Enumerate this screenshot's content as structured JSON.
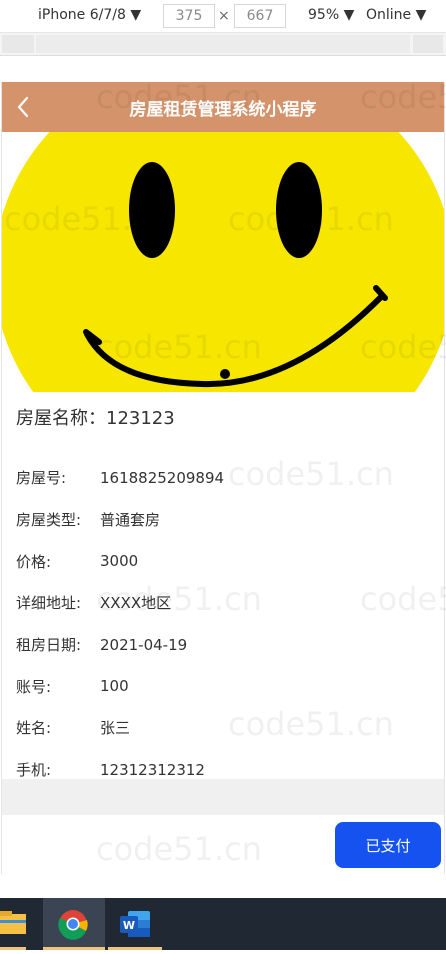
{
  "devtools": {
    "device": "iPhone 6/7/8",
    "width": "375",
    "times": "×",
    "height": "667",
    "zoom": "95%",
    "network": "Online"
  },
  "navbar": {
    "title": "房屋租赁管理系统小程序"
  },
  "house": {
    "name_label": "房屋名称：",
    "name_value": "123123",
    "fields": [
      {
        "label": "房屋号:",
        "value": "1618825209894"
      },
      {
        "label": "房屋类型:",
        "value": "普通套房"
      },
      {
        "label": "价格:",
        "value": "3000"
      },
      {
        "label": "详细地址:",
        "value": "XXXX地区"
      },
      {
        "label": "租房日期:",
        "value": "2021-04-19"
      },
      {
        "label": "账号:",
        "value": "100"
      },
      {
        "label": "姓名:",
        "value": "张三"
      },
      {
        "label": "手机:",
        "value": "12312312312"
      }
    ]
  },
  "action": {
    "paid_label": "已支付"
  },
  "watermark": "code51.cn",
  "colors": {
    "navbar": "#d4936b",
    "button": "#1652f0",
    "smiley": "#f7e600"
  }
}
